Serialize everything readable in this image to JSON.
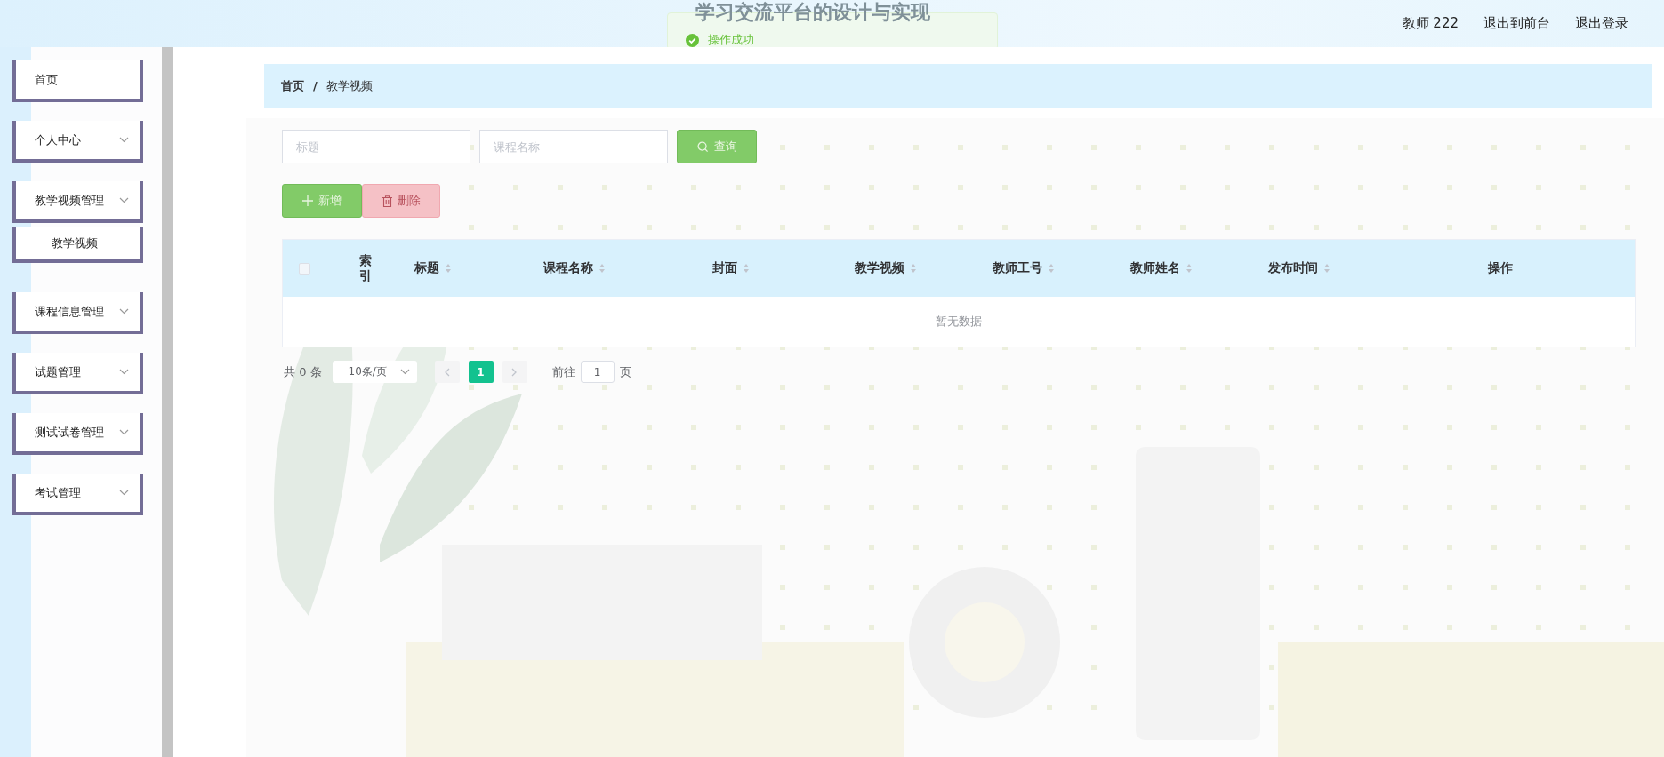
{
  "header": {
    "title": "学习交流平台的设计与实现",
    "toast": "操作成功",
    "links": [
      "教师 222",
      "退出到前台",
      "退出登录"
    ]
  },
  "sidebar": {
    "items": [
      {
        "label": "首页",
        "has_submenu": false
      },
      {
        "label": "个人中心",
        "has_submenu": true
      },
      {
        "label": "教学视频管理",
        "has_submenu": true,
        "children": [
          {
            "label": "教学视频"
          }
        ]
      },
      {
        "label": "课程信息管理",
        "has_submenu": true
      },
      {
        "label": "试题管理",
        "has_submenu": true
      },
      {
        "label": "测试试卷管理",
        "has_submenu": true
      },
      {
        "label": "考试管理",
        "has_submenu": true
      }
    ]
  },
  "breadcrumb": {
    "items": [
      "首页",
      "教学视频"
    ],
    "separator": "/"
  },
  "search": {
    "fields": [
      {
        "placeholder": "标题"
      },
      {
        "placeholder": "课程名称"
      }
    ],
    "button": "查询"
  },
  "actions": [
    {
      "label": "新增",
      "kind": "add"
    },
    {
      "label": "删除",
      "kind": "delete"
    }
  ],
  "table": {
    "select_all_checked": false,
    "columns": [
      {
        "label": "索引",
        "sortable": false
      },
      {
        "label": "标题",
        "sortable": true
      },
      {
        "label": "课程名称",
        "sortable": true
      },
      {
        "label": "封面",
        "sortable": true
      },
      {
        "label": "教学视频",
        "sortable": true
      },
      {
        "label": "教师工号",
        "sortable": true
      },
      {
        "label": "教师姓名",
        "sortable": true
      },
      {
        "label": "发布时间",
        "sortable": true
      },
      {
        "label": "操作",
        "sortable": false
      }
    ],
    "empty_text": "暂无数据"
  },
  "pagination": {
    "total": "共 0 条",
    "page_size": "10条/页",
    "pages": [
      {
        "label": "1",
        "selected": true
      }
    ],
    "goto_label": "前往",
    "goto_value": "1",
    "goto_suffix": "页"
  }
}
